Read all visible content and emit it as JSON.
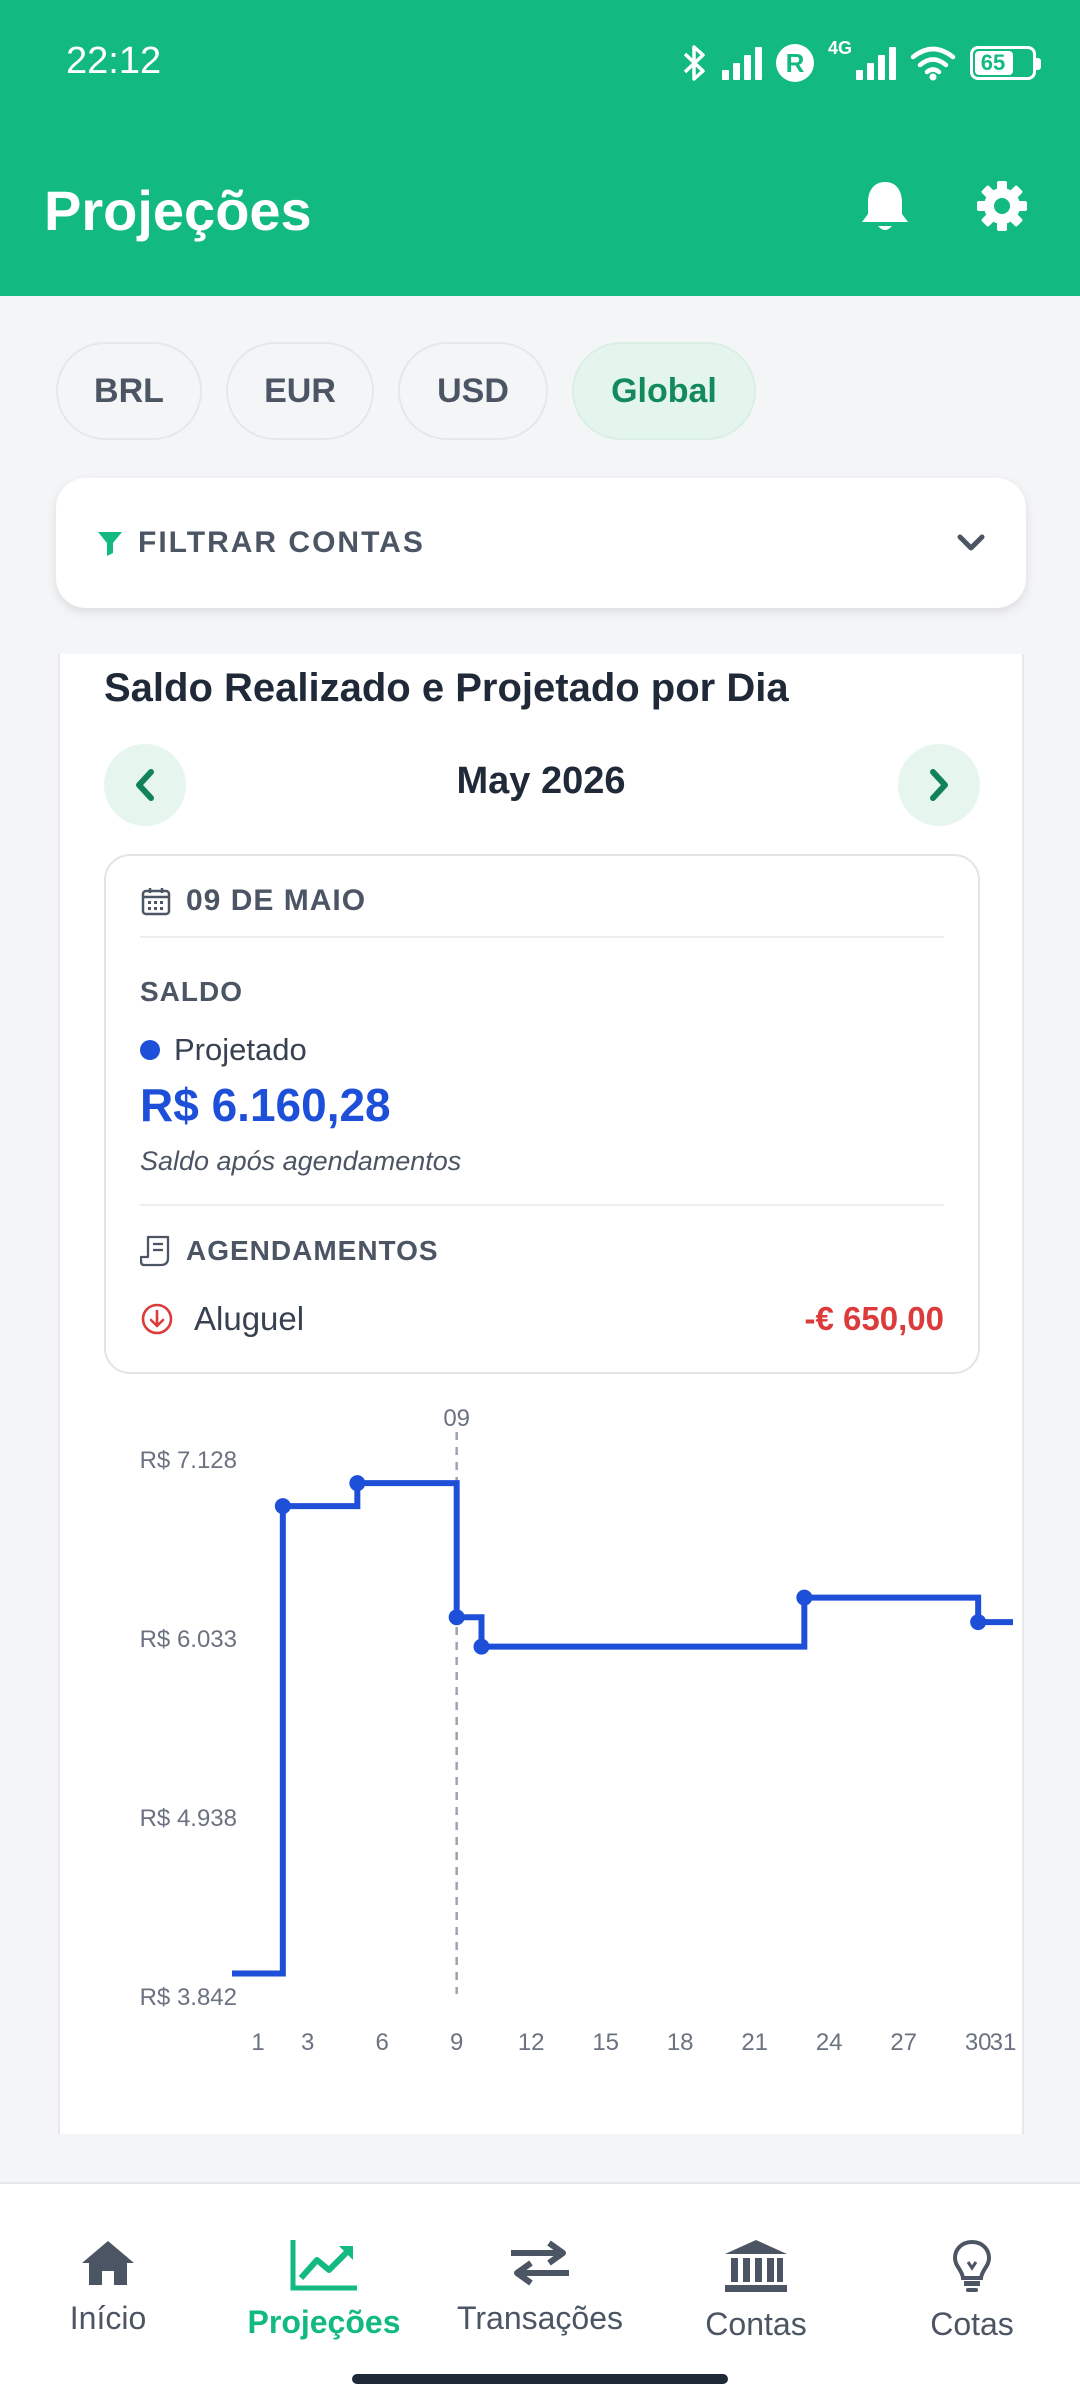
{
  "status_bar": {
    "time": "22:12",
    "network": "4G",
    "battery": "65"
  },
  "header": {
    "title": "Projeções"
  },
  "currency_chips": [
    {
      "label": "BRL",
      "active": false
    },
    {
      "label": "EUR",
      "active": false
    },
    {
      "label": "USD",
      "active": false
    },
    {
      "label": "Global",
      "active": true
    }
  ],
  "filter": {
    "label": "FILTRAR CONTAS"
  },
  "card": {
    "title": "Saldo Realizado e Projetado por Dia",
    "month": "May 2026"
  },
  "detail": {
    "date": "09 DE MAIO",
    "saldo_label": "SALDO",
    "series_label": "Projetado",
    "value": "R$ 6.160,28",
    "note": "Saldo após agendamentos",
    "agendamentos_label": "AGENDAMENTOS",
    "items": [
      {
        "name": "Aluguel",
        "amount": "-€ 650,00"
      }
    ]
  },
  "chart_data": {
    "type": "line",
    "title": "",
    "marker_label": "09",
    "selected_day": 9,
    "step": true,
    "xlim": [
      1,
      31
    ],
    "ylim": [
      3842,
      7128
    ],
    "x_ticks": [
      "1",
      "3",
      "6",
      "9",
      "12",
      "15",
      "18",
      "21",
      "24",
      "27",
      "30",
      "31"
    ],
    "y_ticks": [
      "R$ 7.128",
      "R$ 6.033",
      "R$ 4.938",
      "R$ 3.842"
    ],
    "series": [
      {
        "color": "#1d4fd8",
        "x": [
          1,
          2,
          5,
          9,
          10,
          23,
          30,
          31
        ],
        "y": [
          3980,
          6840,
          6980,
          6160,
          5980,
          6280,
          6130,
          6130
        ]
      }
    ]
  },
  "bottom_nav": [
    {
      "label": "Início",
      "active": false
    },
    {
      "label": "Projeções",
      "active": true
    },
    {
      "label": "Transações",
      "active": false
    },
    {
      "label": "Contas",
      "active": false
    },
    {
      "label": "Cotas",
      "active": false
    }
  ]
}
